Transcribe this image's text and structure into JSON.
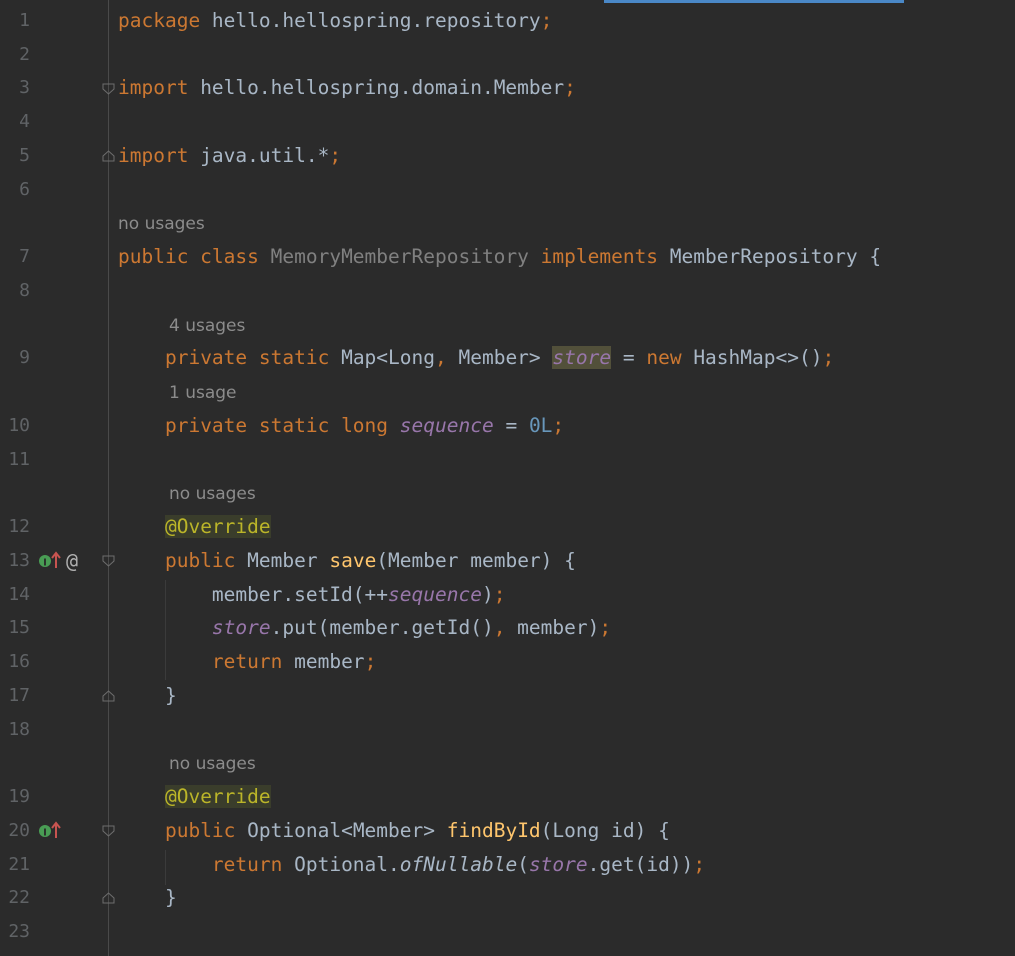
{
  "colors": {
    "background": "#2b2b2b",
    "keyword": "#cc7832",
    "identifier": "#a9b7c6",
    "static_field": "#9876aa",
    "number": "#6897bb",
    "method": "#ffc66d",
    "annotation": "#bbb529",
    "line_number": "#606366"
  },
  "hints": {
    "h7": "no usages",
    "h9": "4 usages",
    "h10": "1 usage",
    "h12": "no usages",
    "h19": "no usages"
  },
  "lines": [
    {
      "n": "1",
      "t": [
        {
          "k": "kw",
          "v": "package"
        },
        {
          "k": "cls",
          "v": " hello.hellospring.repository"
        },
        {
          "k": "kw",
          "v": ";"
        }
      ]
    },
    {
      "n": "2",
      "t": []
    },
    {
      "n": "3",
      "t": [
        {
          "k": "kw",
          "v": "import"
        },
        {
          "k": "cls",
          "v": " hello.hellospring.domain.Member"
        },
        {
          "k": "kw",
          "v": ";"
        }
      ]
    },
    {
      "n": "4",
      "t": []
    },
    {
      "n": "5",
      "t": [
        {
          "k": "kw",
          "v": "import"
        },
        {
          "k": "cls",
          "v": " java.util.*"
        },
        {
          "k": "kw",
          "v": ";"
        }
      ]
    },
    {
      "n": "6",
      "t": []
    },
    {
      "n": "7",
      "t": [
        {
          "k": "kw",
          "v": "public class "
        },
        {
          "k": "unused",
          "v": "MemoryMemberRepository"
        },
        {
          "k": "kw",
          "v": " implements "
        },
        {
          "k": "cls",
          "v": "MemberRepository {"
        }
      ]
    },
    {
      "n": "8",
      "t": []
    },
    {
      "n": "9",
      "t": [
        {
          "k": "cls",
          "v": "    "
        },
        {
          "k": "kw",
          "v": "private static "
        },
        {
          "k": "cls",
          "v": "Map<Long"
        },
        {
          "k": "kw",
          "v": ", "
        },
        {
          "k": "cls",
          "v": "Member> "
        },
        {
          "k": "st hl-store",
          "v": "store"
        },
        {
          "k": "cls",
          "v": " = "
        },
        {
          "k": "kw",
          "v": "new "
        },
        {
          "k": "cls",
          "v": "HashMap<>()"
        },
        {
          "k": "kw",
          "v": ";"
        }
      ]
    },
    {
      "n": "10",
      "t": [
        {
          "k": "cls",
          "v": "    "
        },
        {
          "k": "kw",
          "v": "private static long "
        },
        {
          "k": "st",
          "v": "sequence"
        },
        {
          "k": "cls",
          "v": " = "
        },
        {
          "k": "num",
          "v": "0L"
        },
        {
          "k": "kw",
          "v": ";"
        }
      ]
    },
    {
      "n": "11",
      "t": []
    },
    {
      "n": "12",
      "t": [
        {
          "k": "cls",
          "v": "    "
        },
        {
          "k": "ann",
          "v": "@Override"
        }
      ]
    },
    {
      "n": "13",
      "t": [
        {
          "k": "cls",
          "v": "    "
        },
        {
          "k": "kw",
          "v": "public "
        },
        {
          "k": "cls",
          "v": "Member "
        },
        {
          "k": "fn",
          "v": "save"
        },
        {
          "k": "cls",
          "v": "(Member member) {"
        }
      ]
    },
    {
      "n": "14",
      "t": [
        {
          "k": "cls",
          "v": "        member.setId(++"
        },
        {
          "k": "st",
          "v": "sequence"
        },
        {
          "k": "cls",
          "v": ")"
        },
        {
          "k": "kw",
          "v": ";"
        }
      ]
    },
    {
      "n": "15",
      "t": [
        {
          "k": "cls",
          "v": "        "
        },
        {
          "k": "st",
          "v": "store"
        },
        {
          "k": "cls",
          "v": ".put(member.getId()"
        },
        {
          "k": "kw",
          "v": ", "
        },
        {
          "k": "cls",
          "v": "member)"
        },
        {
          "k": "kw",
          "v": ";"
        }
      ]
    },
    {
      "n": "16",
      "t": [
        {
          "k": "cls",
          "v": "        "
        },
        {
          "k": "kw",
          "v": "return "
        },
        {
          "k": "cls",
          "v": "member"
        },
        {
          "k": "kw",
          "v": ";"
        }
      ]
    },
    {
      "n": "17",
      "t": [
        {
          "k": "cls",
          "v": "    }"
        }
      ]
    },
    {
      "n": "18",
      "t": []
    },
    {
      "n": "19",
      "t": [
        {
          "k": "cls",
          "v": "    "
        },
        {
          "k": "ann",
          "v": "@Override"
        }
      ]
    },
    {
      "n": "20",
      "t": [
        {
          "k": "cls",
          "v": "    "
        },
        {
          "k": "kw",
          "v": "public "
        },
        {
          "k": "cls",
          "v": "Optional<Member> "
        },
        {
          "k": "fn",
          "v": "findById"
        },
        {
          "k": "cls",
          "v": "(Long id) {"
        }
      ]
    },
    {
      "n": "21",
      "t": [
        {
          "k": "cls",
          "v": "        "
        },
        {
          "k": "kw",
          "v": "return "
        },
        {
          "k": "cls",
          "v": "Optional."
        },
        {
          "k": "cls it",
          "v": "ofNullable"
        },
        {
          "k": "cls",
          "v": "("
        },
        {
          "k": "st",
          "v": "store"
        },
        {
          "k": "cls",
          "v": ".get(id))"
        },
        {
          "k": "kw",
          "v": ";"
        }
      ]
    },
    {
      "n": "22",
      "t": [
        {
          "k": "cls",
          "v": "    }"
        }
      ]
    },
    {
      "n": "23",
      "t": []
    }
  ],
  "gutter_icons": {
    "line13": [
      "implements-method-icon",
      "at-sign-icon"
    ],
    "line20": [
      "implements-method-icon"
    ]
  }
}
